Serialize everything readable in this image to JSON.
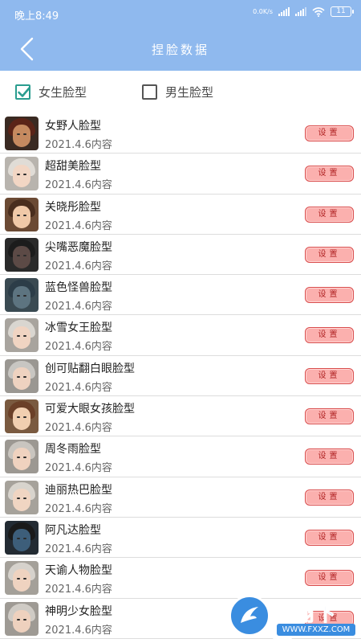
{
  "status_bar": {
    "time": "晚上8:49",
    "speed": "0.0K/s",
    "network": "4G",
    "battery": "11"
  },
  "header": {
    "title": "捏脸数据"
  },
  "filters": [
    {
      "label": "女生脸型",
      "checked": true
    },
    {
      "label": "男生脸型",
      "checked": false
    }
  ],
  "faces": [
    {
      "name": "女野人脸型",
      "subtitle": "2021.4.6内容",
      "button": "设置",
      "hair": "#5a2418",
      "skin": "#c58a60",
      "bg": "#3a2a22"
    },
    {
      "name": "超甜美脸型",
      "subtitle": "2021.4.6内容",
      "button": "设置",
      "hair": "#e0dcd6",
      "skin": "#f2d6c4",
      "bg": "#b8b4ae"
    },
    {
      "name": "关晓彤脸型",
      "subtitle": "2021.4.6内容",
      "button": "设置",
      "hair": "#4a2e1e",
      "skin": "#f0c9a8",
      "bg": "#6b4a34"
    },
    {
      "name": "尖嘴恶魔脸型",
      "subtitle": "2021.4.6内容",
      "button": "设置",
      "hair": "#1c1c1c",
      "skin": "#5c4a46",
      "bg": "#2a2a2a"
    },
    {
      "name": "蓝色怪兽脸型",
      "subtitle": "2021.4.6内容",
      "button": "设置",
      "hair": "#2c3d48",
      "skin": "#5d7480",
      "bg": "#3a4a52"
    },
    {
      "name": "冰雪女王脸型",
      "subtitle": "2021.4.6内容",
      "button": "设置",
      "hair": "#d9d6d0",
      "skin": "#f0d4c2",
      "bg": "#a8a49e"
    },
    {
      "name": "创可贴翻白眼脸型",
      "subtitle": "2021.4.6内容",
      "button": "设置",
      "hair": "#c8c6c2",
      "skin": "#eed2c0",
      "bg": "#9a9792"
    },
    {
      "name": "可爱大眼女孩脸型",
      "subtitle": "2021.4.6内容",
      "button": "设置",
      "hair": "#6b4028",
      "skin": "#f1cfb0",
      "bg": "#7a5a40"
    },
    {
      "name": "周冬雨脸型",
      "subtitle": "2021.4.6内容",
      "button": "设置",
      "hair": "#c9c5bf",
      "skin": "#efd2bf",
      "bg": "#9c9892"
    },
    {
      "name": "迪丽热巴脸型",
      "subtitle": "2021.4.6内容",
      "button": "设置",
      "hair": "#d8d4cd",
      "skin": "#f0d5c2",
      "bg": "#a6a29b"
    },
    {
      "name": "阿凡达脸型",
      "subtitle": "2021.4.6内容",
      "button": "设置",
      "hair": "#1a1a1a",
      "skin": "#3d5e7a",
      "bg": "#232b33"
    },
    {
      "name": "天谕人物脸型",
      "subtitle": "2021.4.6内容",
      "button": "设置",
      "hair": "#d6d2cc",
      "skin": "#efd3c0",
      "bg": "#a4a099"
    },
    {
      "name": "神明少女脸型",
      "subtitle": "2021.4.6内容",
      "button": "设置",
      "hair": "#cfcbc5",
      "skin": "#eed1be",
      "bg": "#9e9a94"
    }
  ],
  "watermark": {
    "text": "飞翔下载",
    "url": "WWW.FXXZ.COM"
  },
  "colors": {
    "header_bg": "#8fb9ee",
    "button_bg": "#fbb0ae",
    "button_border": "#d94b4b",
    "check": "#2a9d8f"
  }
}
